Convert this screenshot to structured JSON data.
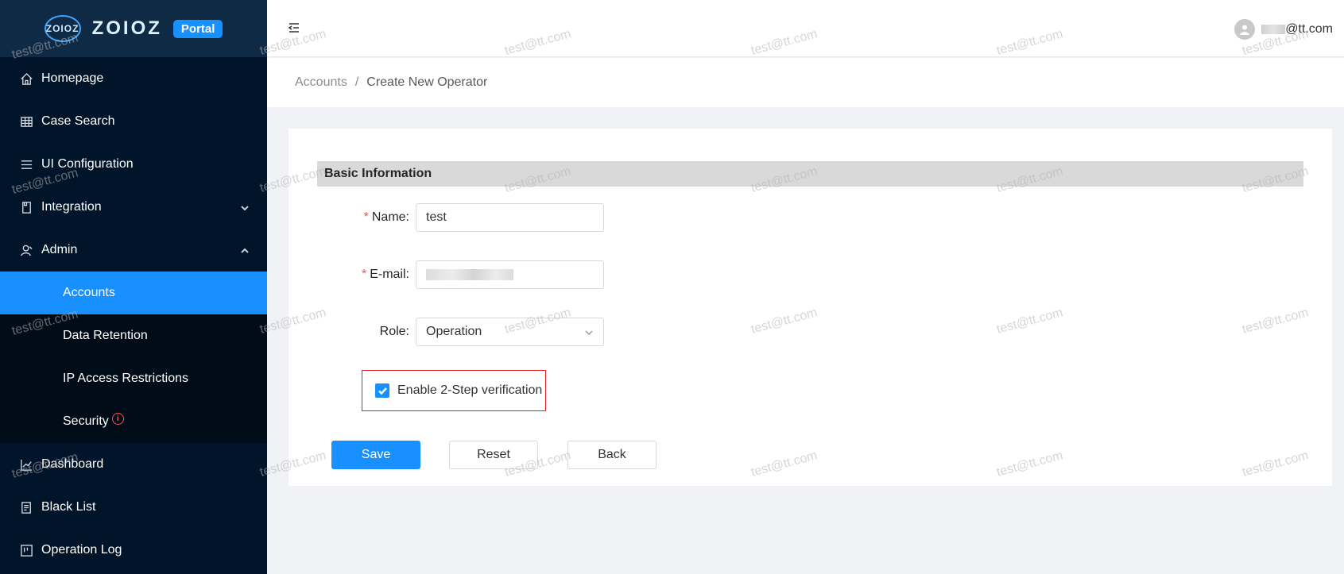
{
  "brand": {
    "logo_mark": "ZOIOZ",
    "logo_text": "ZOIOZ",
    "badge": "Portal"
  },
  "sidebar": {
    "items": [
      {
        "label": "Homepage",
        "icon": "home-icon"
      },
      {
        "label": "Case Search",
        "icon": "table-icon"
      },
      {
        "label": "UI Configuration",
        "icon": "list-icon"
      },
      {
        "label": "Integration",
        "icon": "file-icon",
        "expanded": false
      },
      {
        "label": "Admin",
        "icon": "user-icon",
        "expanded": true
      }
    ],
    "admin_children": [
      {
        "label": "Accounts",
        "active": true
      },
      {
        "label": "Data Retention"
      },
      {
        "label": "IP Access Restrictions"
      },
      {
        "label": "Security",
        "badge_icon": "info-icon"
      }
    ],
    "items_after": [
      {
        "label": "Dashboard",
        "icon": "chart-icon"
      },
      {
        "label": "Black List",
        "icon": "doc-icon"
      },
      {
        "label": "Operation Log",
        "icon": "log-icon"
      }
    ]
  },
  "header": {
    "user_suffix": "@tt.com"
  },
  "breadcrumb": {
    "parent": "Accounts",
    "separator": "/",
    "current": "Create New Operator"
  },
  "form": {
    "section_title": "Basic Information",
    "name_label": "Name",
    "name_value": "test",
    "email_label": "E-mail",
    "role_label": "Role",
    "role_value": "Operation",
    "two_step_label": "Enable 2-Step verification",
    "two_step_checked": true,
    "label_colon": ":"
  },
  "buttons": {
    "save": "Save",
    "reset": "Reset",
    "back": "Back"
  },
  "watermark_text": "test@tt.com",
  "colors": {
    "primary": "#1890ff",
    "sidebar_bg": "#001529",
    "required": "#ff4d4f",
    "highlight_border": "#e02020"
  }
}
